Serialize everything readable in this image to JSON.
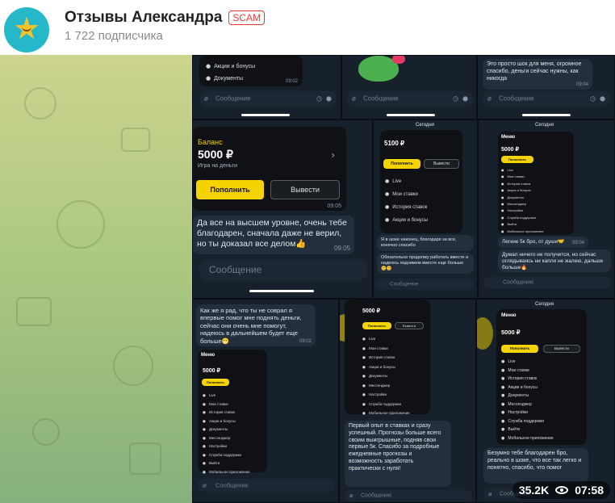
{
  "channel": {
    "name": "Отзывы Александра",
    "badge": "SCAM",
    "subscribers": "1 722 подписчика"
  },
  "post": {
    "views": "35.2K",
    "time": "07:58"
  },
  "colors": {
    "accent_yellow": "#f5d300",
    "scam_red": "#e53935",
    "chat_bg": "#17212b",
    "bubble": "#242f3d"
  },
  "input_placeholder": "Сообщение",
  "shot1": {
    "menu": [
      "Акции и бонусы",
      "Документы"
    ],
    "time": "09:02"
  },
  "shot3": {
    "message": "Это просто шок для меня, огромное спасибо, деньги сейчас нужны, как никогда",
    "time": "09:04"
  },
  "shot4": {
    "balance_label": "Баланс",
    "balance_amount": "5000 ₽",
    "balance_sub": "Игра на деньги",
    "btn_deposit": "Пополнить",
    "btn_withdraw": "Вывести",
    "time_img": "09:05",
    "message": "Да все на высшем уровне, очень тебе благодарен, сначала даже не верил, но ты доказал все делом👍",
    "time_msg": "09:05"
  },
  "shot5": {
    "date": "Сегодня",
    "balance_amount": "5100 ₽",
    "btn_deposit": "Пополнить",
    "btn_withdraw": "Вывести",
    "menu": [
      "Live",
      "Мои ставки",
      "История ставок",
      "Акции и бонусы"
    ],
    "message1": "Я в шоке наконец, благодаря за все, конечно спасибо",
    "message2": "Обязательно продолжу работать вместе и надеюсь поднимем вместе еще больше 😊😊"
  },
  "shot6": {
    "date": "Сегодня",
    "header": "Меню",
    "balance_amount": "5000 ₽",
    "btn_deposit": "Пополнить",
    "menu": [
      "Live",
      "Мои ставки",
      "История ставок",
      "Акции и бонусы",
      "Документы",
      "Мессенджер",
      "Настройки",
      "Служба поддержки",
      "Выйти",
      "Мобильное приложение"
    ],
    "message1": "Легкие 5к бро, от души🤝",
    "time1": "09:04",
    "message2": "Думал ничего не получится, но сейчас оглядываясь ни капли не жалею, дальше больше🔥"
  },
  "shot7": {
    "message": "Как же я рад, что ты не соврал я впервые помог мне поднять деньги, сейчас они очень мне помогут, надеюсь в дальнейшем будет еще больше😁",
    "time": "09:02",
    "header": "Меню",
    "balance_amount": "5000 ₽",
    "btn_deposit": "Пополнить",
    "menu": [
      "Live",
      "Мои ставки",
      "История ставок",
      "Акции и бонусы",
      "Документы",
      "Мессенджер",
      "Настройки",
      "Служба поддержки",
      "Выйти",
      "Мобильное приложение"
    ]
  },
  "shot8": {
    "balance_amount": "5000 ₽",
    "btn_deposit": "Пополнить",
    "btn_withdraw": "Вывести",
    "menu": [
      "Live",
      "Мои ставки",
      "История ставок",
      "Акции и бонусы",
      "Документы",
      "Мессенджер",
      "Настройки",
      "Служба поддержки",
      "Мобильное приложение"
    ],
    "message": "Первый опыт в ставках и сразу успешный. Прогнозы больше всего своим выигрышные, подняв свои первые 5к. Спасибо за подробные ежедневные прогнозы и возможность заработать практически с нуля!"
  },
  "shot9": {
    "date": "Сегодня",
    "header": "Меню",
    "balance_amount": "5000 ₽",
    "btn_deposit": "Пополнить",
    "btn_withdraw": "Вывести",
    "menu": [
      "Live",
      "Мои ставки",
      "История ставок",
      "Акции и бонусы",
      "Документы",
      "Мессенджер",
      "Настройки",
      "Служба поддержки",
      "Выйти",
      "Мобильное приложение"
    ],
    "message": "Безумно тебе благодарен бро, реально в шоке, что все так легко и понятно, спасибо, что помог"
  }
}
